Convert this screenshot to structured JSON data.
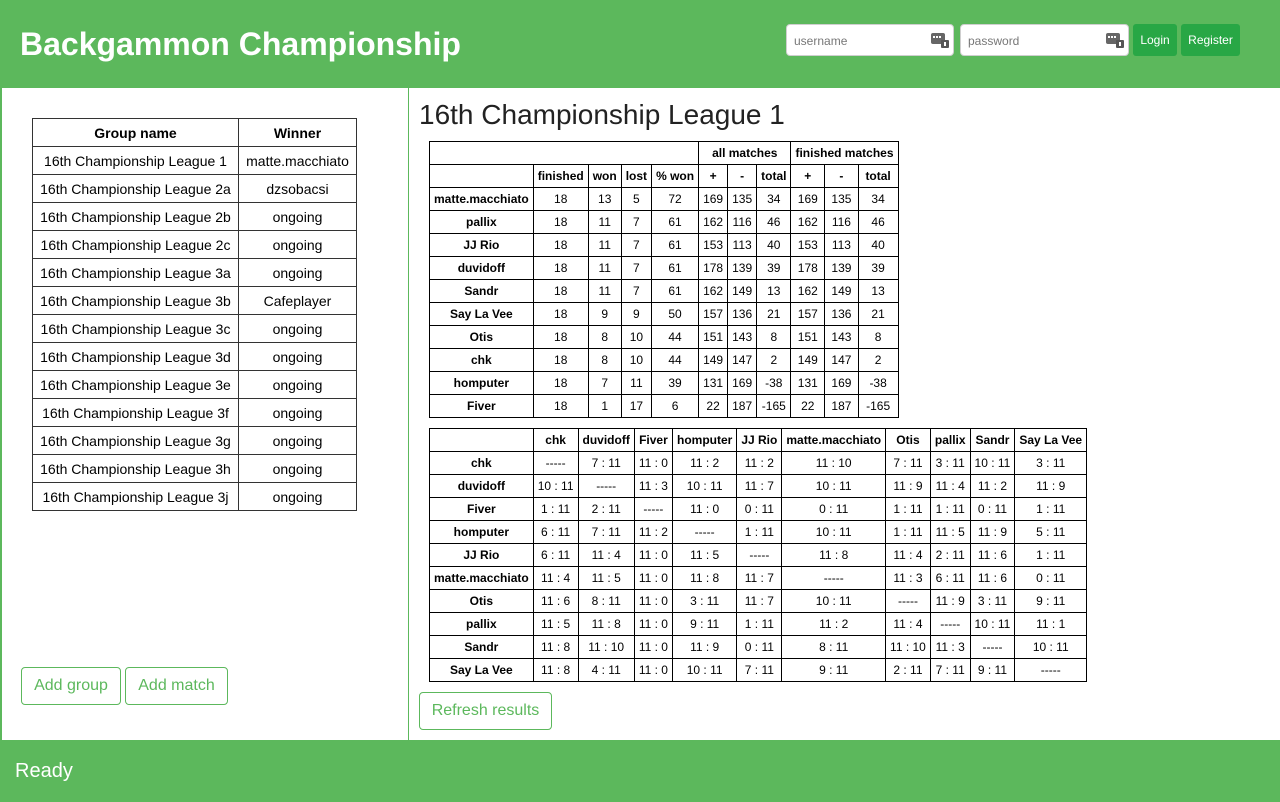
{
  "header": {
    "title": "Backgammon Championship",
    "username_placeholder": "username",
    "password_placeholder": "password",
    "login_label": "Login",
    "register_label": "Register",
    "field_icon": "password-manager-key-icon"
  },
  "groups": {
    "headers": [
      "Group name",
      "Winner"
    ],
    "rows": [
      [
        "16th Championship League 1",
        "matte.macchiato"
      ],
      [
        "16th Championship League 2a",
        "dzsobacsi"
      ],
      [
        "16th Championship League 2b",
        "ongoing"
      ],
      [
        "16th Championship League 2c",
        "ongoing"
      ],
      [
        "16th Championship League 3a",
        "ongoing"
      ],
      [
        "16th Championship League 3b",
        "Cafeplayer"
      ],
      [
        "16th Championship League 3c",
        "ongoing"
      ],
      [
        "16th Championship League 3d",
        "ongoing"
      ],
      [
        "16th Championship League 3e",
        "ongoing"
      ],
      [
        "16th Championship League 3f",
        "ongoing"
      ],
      [
        "16th Championship League 3g",
        "ongoing"
      ],
      [
        "16th Championship League 3h",
        "ongoing"
      ],
      [
        "16th Championship League 3j",
        "ongoing"
      ]
    ],
    "add_group_label": "Add group",
    "add_match_label": "Add match"
  },
  "league": {
    "title": "16th Championship League 1",
    "standings": {
      "group_headers": [
        "all matches",
        "finished matches"
      ],
      "sub_headers": [
        "finished",
        "won",
        "lost",
        "% won",
        "+",
        "-",
        "total",
        "+",
        "-",
        "total"
      ],
      "rows": [
        [
          "matte.macchiato",
          "18",
          "13",
          "5",
          "72",
          "169",
          "135",
          "34",
          "169",
          "135",
          "34"
        ],
        [
          "pallix",
          "18",
          "11",
          "7",
          "61",
          "162",
          "116",
          "46",
          "162",
          "116",
          "46"
        ],
        [
          "JJ Rio",
          "18",
          "11",
          "7",
          "61",
          "153",
          "113",
          "40",
          "153",
          "113",
          "40"
        ],
        [
          "duvidoff",
          "18",
          "11",
          "7",
          "61",
          "178",
          "139",
          "39",
          "178",
          "139",
          "39"
        ],
        [
          "Sandr",
          "18",
          "11",
          "7",
          "61",
          "162",
          "149",
          "13",
          "162",
          "149",
          "13"
        ],
        [
          "Say La Vee",
          "18",
          "9",
          "9",
          "50",
          "157",
          "136",
          "21",
          "157",
          "136",
          "21"
        ],
        [
          "Otis",
          "18",
          "8",
          "10",
          "44",
          "151",
          "143",
          "8",
          "151",
          "143",
          "8"
        ],
        [
          "chk",
          "18",
          "8",
          "10",
          "44",
          "149",
          "147",
          "2",
          "149",
          "147",
          "2"
        ],
        [
          "homputer",
          "18",
          "7",
          "11",
          "39",
          "131",
          "169",
          "-38",
          "131",
          "169",
          "-38"
        ],
        [
          "Fiver",
          "18",
          "1",
          "17",
          "6",
          "22",
          "187",
          "-165",
          "22",
          "187",
          "-165"
        ]
      ]
    },
    "matrix": {
      "columns": [
        "chk",
        "duvidoff",
        "Fiver",
        "homputer",
        "JJ Rio",
        "matte.macchiato",
        "Otis",
        "pallix",
        "Sandr",
        "Say La Vee"
      ],
      "rows": [
        [
          "chk",
          "-----",
          "7 : 11",
          "11 : 0",
          "11 : 2",
          "11 : 2",
          "11 : 10",
          "7 : 11",
          "3 : 11",
          "10 : 11",
          "3 : 11"
        ],
        [
          "duvidoff",
          "10 : 11",
          "-----",
          "11 : 3",
          "10 : 11",
          "11 : 7",
          "10 : 11",
          "11 : 9",
          "11 : 4",
          "11 : 2",
          "11 : 9"
        ],
        [
          "Fiver",
          "1 : 11",
          "2 : 11",
          "-----",
          "11 : 0",
          "0 : 11",
          "0 : 11",
          "1 : 11",
          "1 : 11",
          "0 : 11",
          "1 : 11"
        ],
        [
          "homputer",
          "6 : 11",
          "7 : 11",
          "11 : 2",
          "-----",
          "1 : 11",
          "10 : 11",
          "1 : 11",
          "11 : 5",
          "11 : 9",
          "5 : 11"
        ],
        [
          "JJ Rio",
          "6 : 11",
          "11 : 4",
          "11 : 0",
          "11 : 5",
          "-----",
          "11 : 8",
          "11 : 4",
          "2 : 11",
          "11 : 6",
          "1 : 11"
        ],
        [
          "matte.macchiato",
          "11 : 4",
          "11 : 5",
          "11 : 0",
          "11 : 8",
          "11 : 7",
          "-----",
          "11 : 3",
          "6 : 11",
          "11 : 6",
          "0 : 11"
        ],
        [
          "Otis",
          "11 : 6",
          "8 : 11",
          "11 : 0",
          "3 : 11",
          "11 : 7",
          "10 : 11",
          "-----",
          "11 : 9",
          "3 : 11",
          "9 : 11"
        ],
        [
          "pallix",
          "11 : 5",
          "11 : 8",
          "11 : 0",
          "9 : 11",
          "1 : 11",
          "11 : 2",
          "11 : 4",
          "-----",
          "10 : 11",
          "11 : 1"
        ],
        [
          "Sandr",
          "11 : 8",
          "11 : 10",
          "11 : 0",
          "11 : 9",
          "0 : 11",
          "8 : 11",
          "11 : 10",
          "11 : 3",
          "-----",
          "10 : 11"
        ],
        [
          "Say La Vee",
          "11 : 8",
          "4 : 11",
          "11 : 0",
          "10 : 11",
          "7 : 11",
          "9 : 11",
          "2 : 11",
          "7 : 11",
          "9 : 11",
          "-----"
        ]
      ]
    },
    "refresh_label": "Refresh results"
  },
  "footer": {
    "status": "Ready"
  },
  "colors": {
    "brand": "#5cb85c",
    "button": "#28a745",
    "text_on_brand": "#ffffff"
  }
}
